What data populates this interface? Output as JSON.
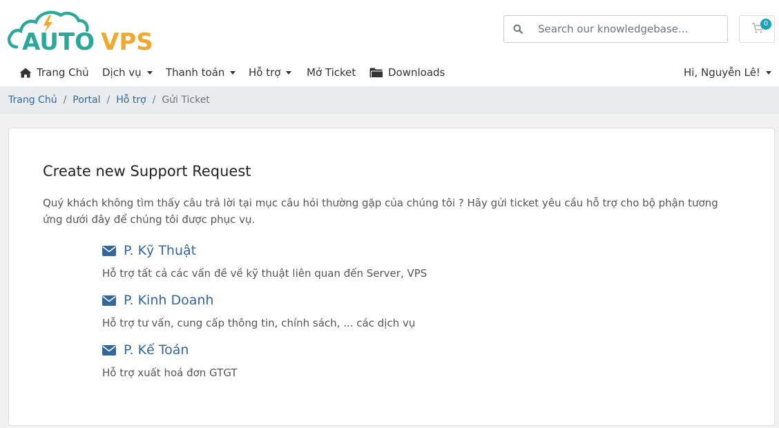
{
  "brand": {
    "logo_text_1": "AUTO",
    "logo_text_2": "VPS",
    "teal": "#2aa99b",
    "orange": "#f0a92e"
  },
  "search": {
    "placeholder": "Search our knowledgebase...",
    "value": ""
  },
  "cart": {
    "count": "0"
  },
  "nav": {
    "items": [
      {
        "label": "Trang Chủ",
        "icon": "home-icon"
      },
      {
        "label": "Dịch vụ",
        "dropdown": true
      },
      {
        "label": "Thanh toán",
        "dropdown": true
      },
      {
        "label": "Hỗ trợ",
        "dropdown": true
      },
      {
        "label": "Mở Ticket"
      },
      {
        "label": "Downloads",
        "icon": "folder-icon"
      }
    ],
    "user": "Hi, Nguyễn Lê!"
  },
  "breadcrumb": {
    "items": [
      "Trang Chủ",
      "Portal",
      "Hỗ trợ"
    ],
    "current": "Gửi Ticket"
  },
  "main": {
    "title": "Create new Support Request",
    "description": "Quý khách không tìm thấy câu trả lời tại mục câu hỏi thường gặp của chúng tôi ? Hãy gửi ticket yêu cầu hỗ trợ cho bộ phận tương ứng dưới đây để chúng tôi được phục vụ.",
    "departments": [
      {
        "name": "P. Kỹ Thuật",
        "description": "Hỗ trợ tất cả các vấn đề về kỹ thuật liên quan đến Server, VPS"
      },
      {
        "name": "P. Kinh Doanh",
        "description": "Hỗ trợ tư vấn, cung cấp thông tin, chính sách, ... các dịch vụ"
      },
      {
        "name": "P. Kế Toán",
        "description": "Hỗ trợ xuất hoá đơn GTGT"
      }
    ]
  },
  "colors": {
    "link": "#336699",
    "breadcrumb_bg": "#e9ecef",
    "badge": "#17a2b8"
  }
}
